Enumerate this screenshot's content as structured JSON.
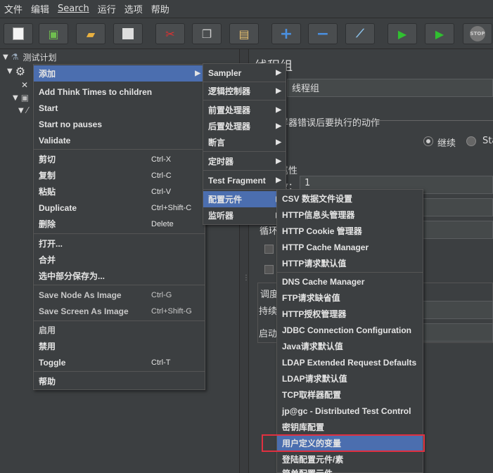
{
  "menubar": [
    "文件",
    "编辑",
    "Search",
    "运行",
    "选项",
    "帮助"
  ],
  "toolbar_icons": [
    "new-icon",
    "templates-icon",
    "open-icon",
    "save-icon",
    "cut-icon",
    "copy-icon",
    "paste-icon",
    "expand-icon",
    "collapse-icon",
    "toggle-icon",
    "start-icon",
    "start-no-pause-icon",
    "stop-icon"
  ],
  "tree": {
    "root": "测试计划"
  },
  "right": {
    "title": "线程组",
    "name_value": "线程组",
    "on_error_label": "样器错误后要执行的动作",
    "continue_label": "继续",
    "start_next_label": "Sta",
    "props_label": "属性",
    "threads_label": "数：",
    "threads_value": "1",
    "loop_label": "循环",
    "schedule_label": "调度",
    "duration_label": "持续",
    "delay_label": "启动"
  },
  "context_menu": {
    "items": [
      {
        "label": "添加",
        "has_submenu": true,
        "selected": true
      },
      {
        "label": "Add Think Times to children"
      },
      {
        "label": "Start"
      },
      {
        "label": "Start no pauses"
      },
      {
        "label": "Validate"
      },
      {
        "label": "剪切",
        "shortcut": "Ctrl-X"
      },
      {
        "label": "复制",
        "shortcut": "Ctrl-C"
      },
      {
        "label": "粘贴",
        "shortcut": "Ctrl-V"
      },
      {
        "label": "Duplicate",
        "shortcut": "Ctrl+Shift-C"
      },
      {
        "label": "删除",
        "shortcut": "Delete"
      },
      {
        "label": "打开..."
      },
      {
        "label": "合并"
      },
      {
        "label": "选中部分保存为..."
      },
      {
        "label": "Save Node As Image",
        "shortcut": "Ctrl-G"
      },
      {
        "label": "Save Screen As Image",
        "shortcut": "Ctrl+Shift-G"
      },
      {
        "label": "启用"
      },
      {
        "label": "禁用"
      },
      {
        "label": "Toggle",
        "shortcut": "Ctrl-T"
      },
      {
        "label": "帮助"
      }
    ]
  },
  "add_menu": {
    "items": [
      {
        "label": "Sampler"
      },
      {
        "label": "逻辑控制器"
      },
      {
        "label": "前置处理器"
      },
      {
        "label": "后置处理器"
      },
      {
        "label": "断言"
      },
      {
        "label": "定时器"
      },
      {
        "label": "Test Fragment"
      },
      {
        "label": "配置元件",
        "selected": true
      },
      {
        "label": "监听器"
      }
    ]
  },
  "config_menu": {
    "items": [
      "CSV 数据文件设置",
      "HTTP信息头管理器",
      "HTTP Cookie 管理器",
      "HTTP Cache Manager",
      "HTTP请求默认值",
      "DNS Cache Manager",
      "FTP请求缺省值",
      "HTTP授权管理器",
      "JDBC Connection Configuration",
      "Java请求默认值",
      "LDAP Extended Request Defaults",
      "LDAP请求默认值",
      "TCP取样器配置",
      "jp@gc - Distributed Test Control",
      "密钥库配置",
      "用户定义的变量",
      "登陆配置元件/素",
      "简单配置元件"
    ],
    "highlighted": "用户定义的变量"
  }
}
